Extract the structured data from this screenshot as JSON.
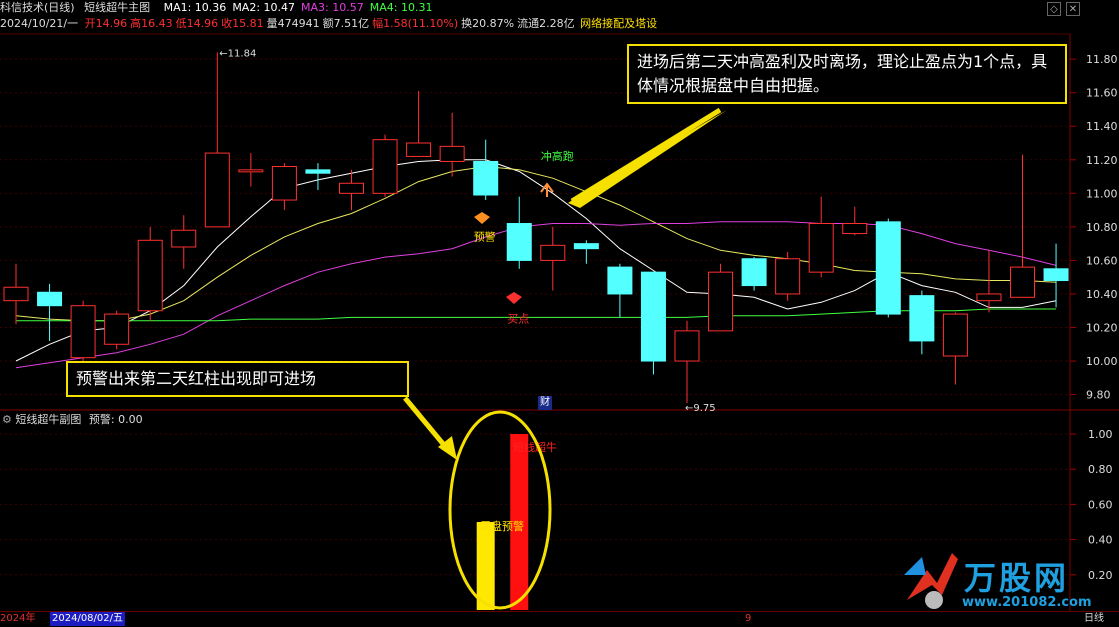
{
  "window": {
    "stock_name": "科信技术(日线)",
    "indicator_name": "短线超牛主图",
    "ma_items": [
      {
        "label": "MA1: 10.36",
        "color": "#ffffff"
      },
      {
        "label": "MA2: 10.47",
        "color": "#ffffff"
      },
      {
        "label": "MA3: 10.57",
        "color": "#e040e0"
      },
      {
        "label": "MA4: 10.31",
        "color": "#40ff40"
      }
    ],
    "date": "2024/10/21/一",
    "quote": [
      {
        "label": "开",
        "value": "14.96",
        "color": "#ff3030"
      },
      {
        "label": "高",
        "value": "16.43",
        "color": "#ff3030"
      },
      {
        "label": "低",
        "value": "14.96",
        "color": "#ff3030"
      },
      {
        "label": "收",
        "value": "15.81",
        "color": "#ff3030"
      },
      {
        "label": "量",
        "value": "474941",
        "color": "#dddddd"
      },
      {
        "label": "额",
        "value": "7.51亿",
        "color": "#dddddd"
      },
      {
        "label": "幅",
        "value": "1.58(11.10%)",
        "color": "#ff3030"
      },
      {
        "label": "换",
        "value": "20.87%",
        "color": "#dddddd"
      },
      {
        "label": "流通",
        "value": "2.28亿",
        "color": "#dddddd"
      }
    ],
    "concept": "网络接配及塔设",
    "diamond_icon": "diamond-icon",
    "close_icon": "close-icon",
    "sub_title": "短线超牛副图",
    "sub_value": "预警: 0.00",
    "sub_icon": "gear-icon",
    "period": "日线",
    "bottom_year": "2024年",
    "bottom_date": "2024/08/02/五",
    "bottom_marker": "9",
    "fin_badge": "财",
    "watermark": "万股网",
    "watermark_url": "www.201082.com"
  },
  "callouts": {
    "top": "进场后第二天冲高盈利及时离场，理论止盈点为1个点，具体情况根据盘中自由把握。",
    "bottom": "预警出来第二天红柱出现即可进场"
  },
  "chart_data": [
    {
      "type": "candlestick",
      "title": "短线超牛主图",
      "y_ticks": [
        "11.80",
        "11.60",
        "11.40",
        "11.20",
        "11.00",
        "10.80",
        "10.60",
        "10.40",
        "10.20",
        "10.00",
        "9.80"
      ],
      "ylim": [
        9.72,
        11.95
      ],
      "high_label": "11.84",
      "low_label": "9.75",
      "candles": [
        {
          "o": 10.36,
          "c": 10.44,
          "h": 10.58,
          "l": 10.22
        },
        {
          "o": 10.41,
          "c": 10.33,
          "h": 10.46,
          "l": 10.12
        },
        {
          "o": 10.02,
          "c": 10.33,
          "h": 10.36,
          "l": 10.0
        },
        {
          "o": 10.1,
          "c": 10.28,
          "h": 10.3,
          "l": 10.07
        },
        {
          "o": 10.3,
          "c": 10.72,
          "h": 10.8,
          "l": 10.24
        },
        {
          "o": 10.68,
          "c": 10.78,
          "h": 10.87,
          "l": 10.55
        },
        {
          "o": 10.8,
          "c": 11.24,
          "h": 11.84,
          "l": 10.8
        },
        {
          "o": 11.14,
          "c": 11.14,
          "h": 11.24,
          "l": 11.04
        },
        {
          "o": 10.96,
          "c": 11.16,
          "h": 11.18,
          "l": 10.9
        },
        {
          "o": 11.14,
          "c": 11.12,
          "h": 11.18,
          "l": 11.02
        },
        {
          "o": 11.0,
          "c": 11.06,
          "h": 11.14,
          "l": 10.9
        },
        {
          "o": 11.0,
          "c": 11.32,
          "h": 11.35,
          "l": 10.98
        },
        {
          "o": 11.22,
          "c": 11.3,
          "h": 11.61,
          "l": 11.22
        },
        {
          "o": 11.19,
          "c": 11.28,
          "h": 11.48,
          "l": 11.1
        },
        {
          "o": 11.19,
          "c": 10.99,
          "h": 11.32,
          "l": 10.96
        },
        {
          "o": 10.82,
          "c": 10.6,
          "h": 10.98,
          "l": 10.55
        },
        {
          "o": 10.6,
          "c": 10.69,
          "h": 10.8,
          "l": 10.42
        },
        {
          "o": 10.7,
          "c": 10.67,
          "h": 10.72,
          "l": 10.58
        },
        {
          "o": 10.56,
          "c": 10.4,
          "h": 10.58,
          "l": 10.26
        },
        {
          "o": 10.53,
          "c": 10.0,
          "h": 10.53,
          "l": 9.92
        },
        {
          "o": 10.0,
          "c": 10.18,
          "h": 10.24,
          "l": 9.75
        },
        {
          "o": 10.18,
          "c": 10.53,
          "h": 10.58,
          "l": 10.18
        },
        {
          "o": 10.61,
          "c": 10.45,
          "h": 10.62,
          "l": 10.42
        },
        {
          "o": 10.4,
          "c": 10.61,
          "h": 10.65,
          "l": 10.36
        },
        {
          "o": 10.53,
          "c": 10.82,
          "h": 10.98,
          "l": 10.5
        },
        {
          "o": 10.76,
          "c": 10.82,
          "h": 10.92,
          "l": 10.75
        },
        {
          "o": 10.83,
          "c": 10.28,
          "h": 10.85,
          "l": 10.26
        },
        {
          "o": 10.39,
          "c": 10.12,
          "h": 10.42,
          "l": 10.04
        },
        {
          "o": 10.03,
          "c": 10.28,
          "h": 10.29,
          "l": 9.86
        },
        {
          "o": 10.36,
          "c": 10.4,
          "h": 10.66,
          "l": 10.29
        },
        {
          "o": 10.38,
          "c": 10.56,
          "h": 11.23,
          "l": 10.38
        },
        {
          "o": 10.55,
          "c": 10.48,
          "h": 10.7,
          "l": 10.32
        }
      ],
      "ma_lines": [
        {
          "name": "MA1",
          "color": "#ffffff",
          "values": [
            10.0,
            10.1,
            10.18,
            10.2,
            10.3,
            10.45,
            10.68,
            10.86,
            11.03,
            11.08,
            11.12,
            11.16,
            11.19,
            11.2,
            11.2,
            11.13,
            11.0,
            10.85,
            10.67,
            10.54,
            10.41,
            10.4,
            10.38,
            10.31,
            10.35,
            10.42,
            10.53,
            10.45,
            10.41,
            10.32,
            10.32,
            10.36
          ]
        },
        {
          "name": "MA2",
          "color": "#e8e860",
          "values": [
            10.27,
            10.25,
            10.24,
            10.24,
            10.28,
            10.36,
            10.5,
            10.63,
            10.74,
            10.82,
            10.88,
            10.97,
            11.07,
            11.13,
            11.16,
            11.14,
            11.09,
            11.01,
            10.93,
            10.83,
            10.73,
            10.66,
            10.63,
            10.61,
            10.58,
            10.54,
            10.53,
            10.52,
            10.49,
            10.48,
            10.48,
            10.47
          ]
        },
        {
          "name": "MA3",
          "color": "#e040e0",
          "values": [
            9.96,
            9.99,
            10.02,
            10.05,
            10.1,
            10.16,
            10.27,
            10.36,
            10.45,
            10.53,
            10.58,
            10.62,
            10.64,
            10.67,
            10.74,
            10.8,
            10.82,
            10.82,
            10.81,
            10.82,
            10.82,
            10.83,
            10.83,
            10.83,
            10.82,
            10.82,
            10.81,
            10.76,
            10.7,
            10.66,
            10.62,
            10.57
          ]
        },
        {
          "name": "MA4",
          "color": "#40ff40",
          "values": [
            10.24,
            10.24,
            10.24,
            10.24,
            10.24,
            10.24,
            10.24,
            10.25,
            10.25,
            10.25,
            10.26,
            10.26,
            10.26,
            10.26,
            10.26,
            10.26,
            10.26,
            10.26,
            10.26,
            10.26,
            10.26,
            10.27,
            10.27,
            10.27,
            10.28,
            10.29,
            10.3,
            10.3,
            10.3,
            10.31,
            10.31,
            10.31
          ]
        }
      ],
      "annotations": [
        {
          "text": "冲高跑",
          "index": 16,
          "y": 11.2,
          "color": "#40ff40"
        },
        {
          "text": "预警",
          "index": 14,
          "y": 10.72,
          "color": "#ffe000"
        },
        {
          "text": "买点",
          "index": 15,
          "y": 10.23,
          "color": "#ff3030"
        }
      ]
    },
    {
      "type": "bar",
      "title": "短线超牛副图",
      "y_ticks": [
        "1.00",
        "0.80",
        "0.60",
        "0.40",
        "0.20"
      ],
      "ylim": [
        0,
        1.0
      ],
      "bars": [
        {
          "index": 14,
          "value": 0.5,
          "color": "#ffe800"
        },
        {
          "index": 15,
          "value": 1.0,
          "color": "#ff1010"
        }
      ],
      "labels": [
        {
          "text": "尾盘预警",
          "color": "#ffe000"
        },
        {
          "text": "短线超牛",
          "color": "#ff2020"
        }
      ]
    }
  ]
}
